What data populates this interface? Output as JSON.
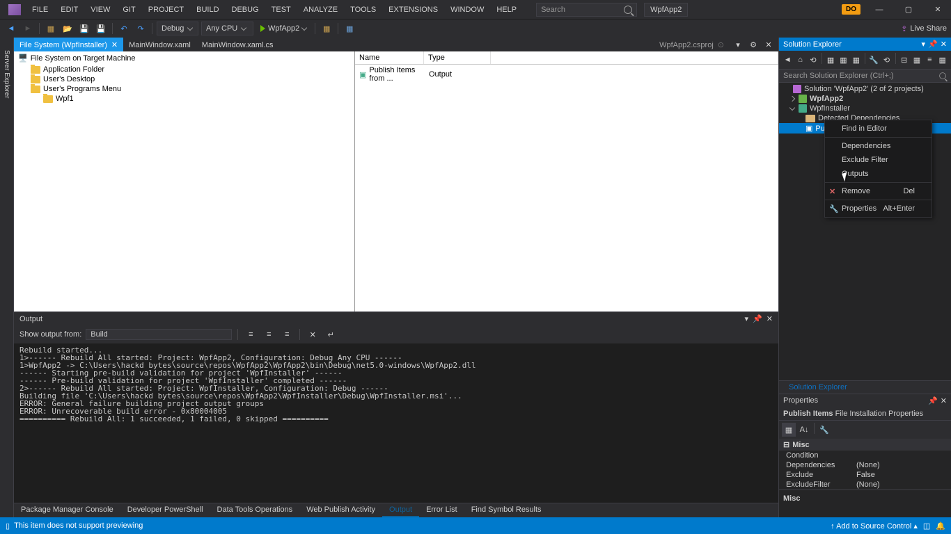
{
  "menu": [
    "FILE",
    "EDIT",
    "VIEW",
    "GIT",
    "PROJECT",
    "BUILD",
    "DEBUG",
    "TEST",
    "ANALYZE",
    "TOOLS",
    "EXTENSIONS",
    "WINDOW",
    "HELP"
  ],
  "search_placeholder": "Search",
  "app_name": "WpfApp2",
  "user_initials": "DO",
  "live_share": "Live Share",
  "toolbar": {
    "config": "Debug",
    "platform": "Any CPU",
    "run_target": "WpfApp2"
  },
  "side_tab": "Server Explorer",
  "doc_tabs": [
    {
      "label": "File System (WpfInstaller)",
      "active": true,
      "closeable": true
    },
    {
      "label": "MainWindow.xaml",
      "active": false
    },
    {
      "label": "MainWindow.xaml.cs",
      "active": false
    }
  ],
  "right_doc_tab": "WpfApp2.csproj",
  "filesystem": {
    "root": "File System on Target Machine",
    "folders": [
      "Application Folder",
      "User's Desktop",
      "User's Programs Menu"
    ],
    "subfolder": "Wpf1"
  },
  "list": {
    "col_name": "Name",
    "col_type": "Type",
    "row_name": "Publish Items from ...",
    "row_type": "Output"
  },
  "solution_explorer": {
    "title": "Solution Explorer",
    "search_placeholder": "Search Solution Explorer (Ctrl+;)",
    "solution": "Solution 'WpfApp2' (2 of 2 projects)",
    "proj1": "WpfApp2",
    "proj2": "WpfInstaller",
    "dep_folder": "Detected Dependencies",
    "selected_node": "Publ",
    "footer_tab": "Solution Explorer"
  },
  "context_menu": {
    "find": "Find in Editor",
    "deps": "Dependencies",
    "exclude": "Exclude Filter",
    "outputs": "Outputs",
    "remove": "Remove",
    "remove_key": "Del",
    "props": "Properties",
    "props_key": "Alt+Enter"
  },
  "properties": {
    "title": "Properties",
    "object": "Publish Items",
    "object_type": "File Installation Properties",
    "category": "Misc",
    "rows": [
      {
        "k": "Condition",
        "v": ""
      },
      {
        "k": "Dependencies",
        "v": "(None)"
      },
      {
        "k": "Exclude",
        "v": "False"
      },
      {
        "k": "ExcludeFilter",
        "v": "(None)"
      }
    ],
    "desc_title": "Misc"
  },
  "output": {
    "title": "Output",
    "show_label": "Show output from:",
    "source": "Build",
    "text": "Rebuild started...\n1>------ Rebuild All started: Project: WpfApp2, Configuration: Debug Any CPU ------\n1>WpfApp2 -> C:\\Users\\hackd bytes\\source\\repos\\WpfApp2\\WpfApp2\\bin\\Debug\\net5.0-windows\\WpfApp2.dll\n------ Starting pre-build validation for project 'WpfInstaller' ------\n------ Pre-build validation for project 'WpfInstaller' completed ------\n2>------ Rebuild All started: Project: WpfInstaller, Configuration: Debug ------\nBuilding file 'C:\\Users\\hackd bytes\\source\\repos\\WpfApp2\\WpfInstaller\\Debug\\WpfInstaller.msi'...\nERROR: General failure building project output groups\nERROR: Unrecoverable build error - 0x80004005\n========== Rebuild All: 1 succeeded, 1 failed, 0 skipped =========="
  },
  "output_tabs": [
    "Package Manager Console",
    "Developer PowerShell",
    "Data Tools Operations",
    "Web Publish Activity",
    "Output",
    "Error List",
    "Find Symbol Results"
  ],
  "output_active_tab": "Output",
  "status": {
    "message": "This item does not support previewing",
    "add_source": "Add to Source Control"
  }
}
